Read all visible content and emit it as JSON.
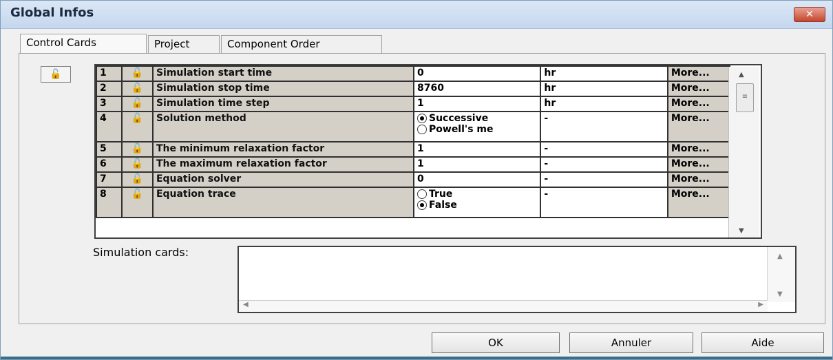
{
  "window": {
    "title": "Global Infos",
    "close_label": "✕"
  },
  "tabs": [
    {
      "label": "Control Cards",
      "active": true
    },
    {
      "label": "Project",
      "active": false
    },
    {
      "label": "Component Order",
      "active": false
    }
  ],
  "lock_icon": "lock-icon",
  "rows": [
    {
      "num": "1",
      "desc": "Simulation start time",
      "value": "0",
      "unit": "hr",
      "more": "More..."
    },
    {
      "num": "2",
      "desc": "Simulation stop time",
      "value": "8760",
      "unit": "hr",
      "more": "More..."
    },
    {
      "num": "3",
      "desc": "Simulation time step",
      "value": "1",
      "unit": "hr",
      "more": "More..."
    },
    {
      "num": "4",
      "desc": "Solution method",
      "options": [
        {
          "label": "Successive",
          "selected": true
        },
        {
          "label": "Powell's me",
          "selected": false
        }
      ],
      "unit": "-",
      "more": "More..."
    },
    {
      "num": "5",
      "desc": "The minimum relaxation factor",
      "value": "1",
      "unit": "-",
      "more": "More..."
    },
    {
      "num": "6",
      "desc": "The maximum relaxation factor",
      "value": "1",
      "unit": "-",
      "more": "More..."
    },
    {
      "num": "7",
      "desc": "Equation solver",
      "value": "0",
      "unit": "-",
      "more": "More..."
    },
    {
      "num": "8",
      "desc": "Equation trace",
      "options": [
        {
          "label": "True",
          "selected": false
        },
        {
          "label": "False",
          "selected": true
        }
      ],
      "unit": "-",
      "more": "More..."
    }
  ],
  "simulation": {
    "label": "Simulation cards:",
    "value": ""
  },
  "buttons": {
    "ok": "OK",
    "cancel": "Annuler",
    "help": "Aide"
  }
}
